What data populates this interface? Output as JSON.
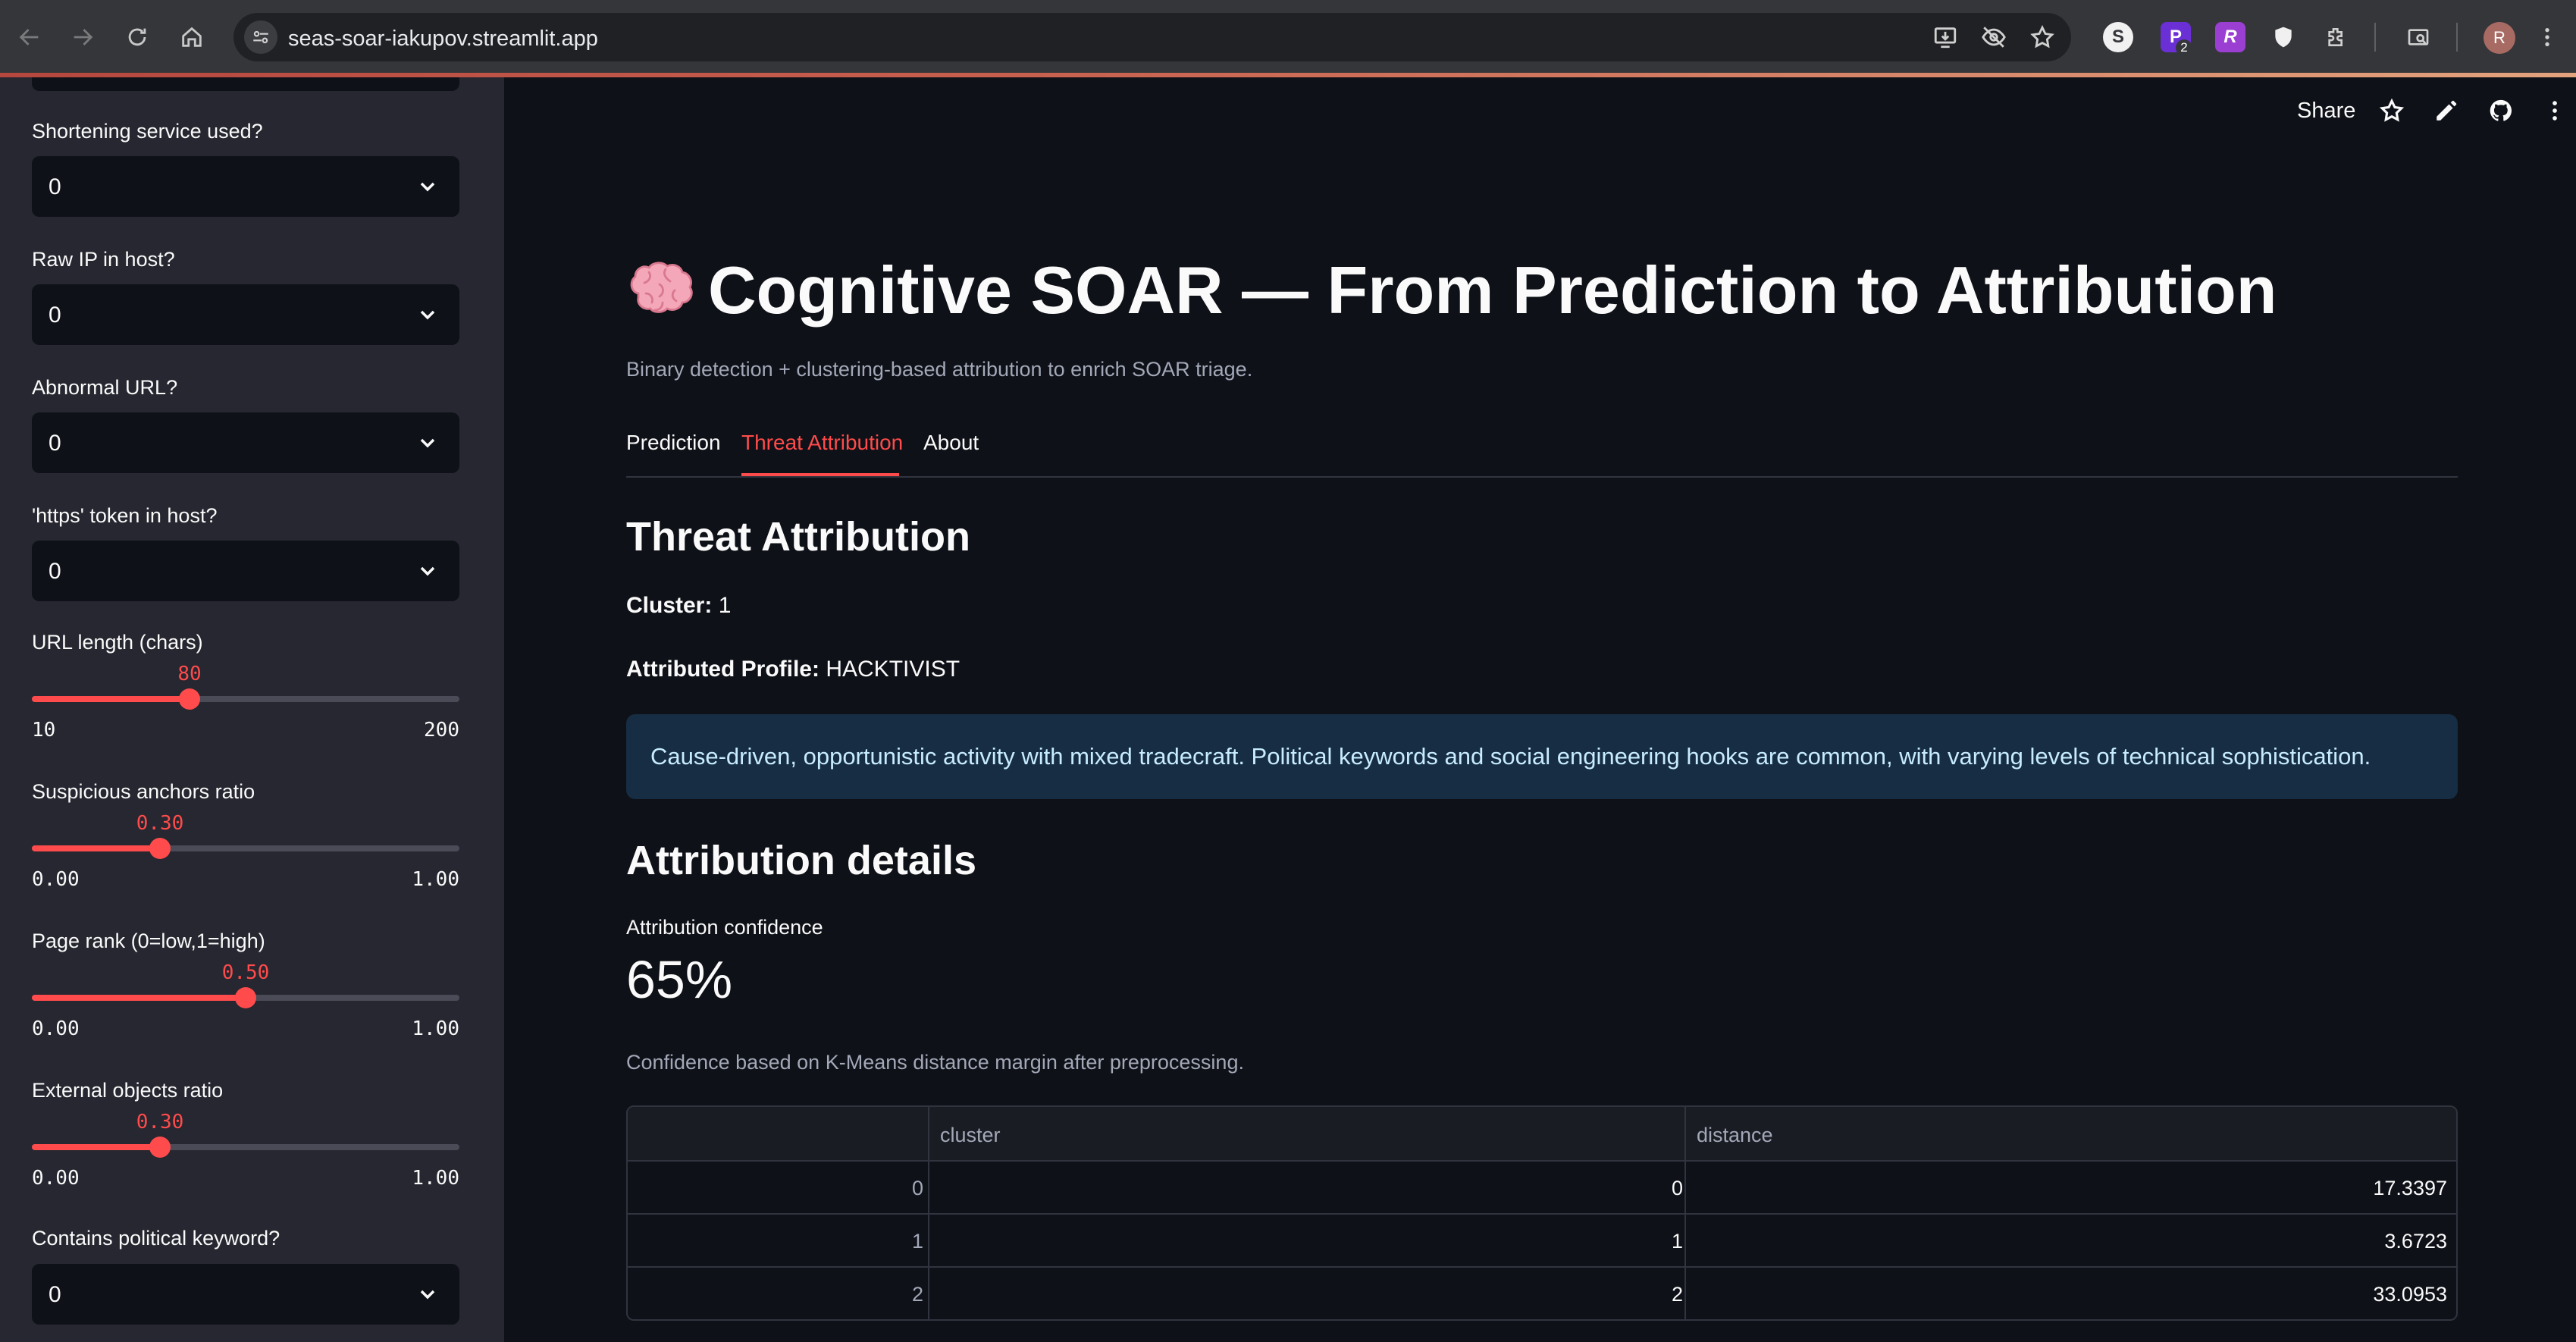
{
  "browser": {
    "url": "seas-soar-iakupov.streamlit.app",
    "extensions": [
      "S",
      "P",
      "R"
    ],
    "ext_badge": "2",
    "profile_initial": "R"
  },
  "toolbar": {
    "share_label": "Share"
  },
  "sidebar": {
    "selects": [
      {
        "label": "Shortening service used?",
        "value": "0"
      },
      {
        "label": "Raw IP in host?",
        "value": "0"
      },
      {
        "label": "Abnormal URL?",
        "value": "0"
      },
      {
        "label": "'https' token in host?",
        "value": "0"
      },
      {
        "label": "Contains political keyword?",
        "value": "0"
      }
    ],
    "sliders": [
      {
        "label": "URL length (chars)",
        "value": "80",
        "min": "10",
        "max": "200",
        "fraction": 0.3684
      },
      {
        "label": "Suspicious anchors ratio",
        "value": "0.30",
        "min": "0.00",
        "max": "1.00",
        "fraction": 0.3
      },
      {
        "label": "Page rank (0=low,1=high)",
        "value": "0.50",
        "min": "0.00",
        "max": "1.00",
        "fraction": 0.5
      },
      {
        "label": "External objects ratio",
        "value": "0.30",
        "min": "0.00",
        "max": "1.00",
        "fraction": 0.3
      }
    ]
  },
  "main": {
    "title": "Cognitive SOAR — From Prediction to Attribution",
    "caption": "Binary detection + clustering-based attribution to enrich SOAR triage.",
    "tabs": [
      "Prediction",
      "Threat Attribution",
      "About"
    ],
    "active_tab": "Threat Attribution",
    "section_title": "Threat Attribution",
    "cluster_label": "Cluster:",
    "cluster_value": "1",
    "profile_label": "Attributed Profile:",
    "profile_value": "HACKTIVIST",
    "info_text": "Cause-driven, opportunistic activity with mixed tradecraft. Political keywords and social engineering hooks are common, with varying levels of technical sophistication.",
    "details_title": "Attribution details",
    "metric_label": "Attribution confidence",
    "metric_value": "65%",
    "note": "Confidence based on K-Means distance margin after preprocessing.",
    "table": {
      "columns": [
        "",
        "cluster",
        "distance"
      ],
      "rows": [
        [
          "0",
          "0",
          "17.3397"
        ],
        [
          "1",
          "1",
          "3.6723"
        ],
        [
          "2",
          "2",
          "33.0953"
        ]
      ]
    }
  }
}
